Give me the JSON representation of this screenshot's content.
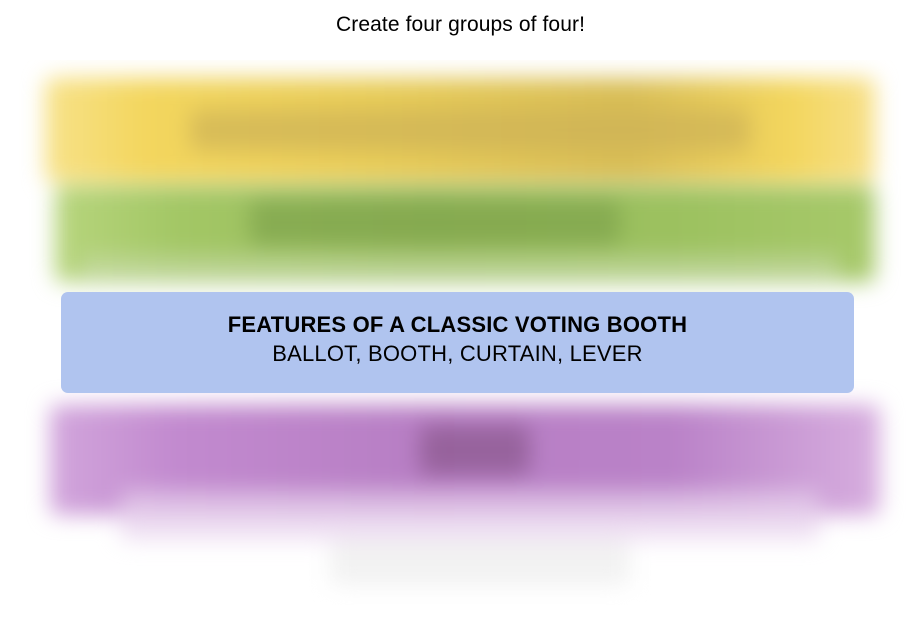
{
  "game": {
    "instructions": "Create four groups of four!"
  },
  "solved_groups": [
    {
      "category": "FEATURES OF A CLASSIC VOTING BOOTH",
      "members": "BALLOT, BOOTH, CURTAIN, LEVER",
      "color": "#b0c4ef"
    }
  ],
  "hidden_rows": [
    {
      "color": "#f3d65e",
      "state": "blurred"
    },
    {
      "color": "#a3c765",
      "state": "blurred"
    },
    {
      "color": "#bb82c9",
      "state": "blurred"
    }
  ]
}
